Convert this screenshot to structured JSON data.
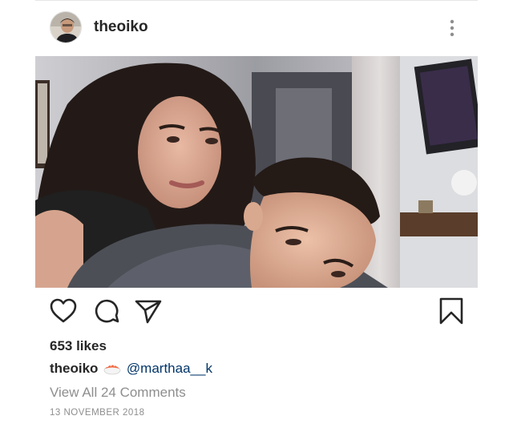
{
  "post": {
    "username": "theoiko",
    "likes": "653 likes",
    "caption_user": "theoiko",
    "caption_emoji": "sushi-icon",
    "caption_mention": "@marthaa__k",
    "view_comments": "View All 24 Comments",
    "date": "13 NOVEMBER 2018"
  },
  "icons": {
    "more": "more-vertical-icon",
    "like": "heart-icon",
    "comment": "comment-icon",
    "share": "send-icon",
    "save": "bookmark-icon"
  },
  "colors": {
    "text": "#262626",
    "muted": "#8e8e8e",
    "mention": "#003569"
  }
}
